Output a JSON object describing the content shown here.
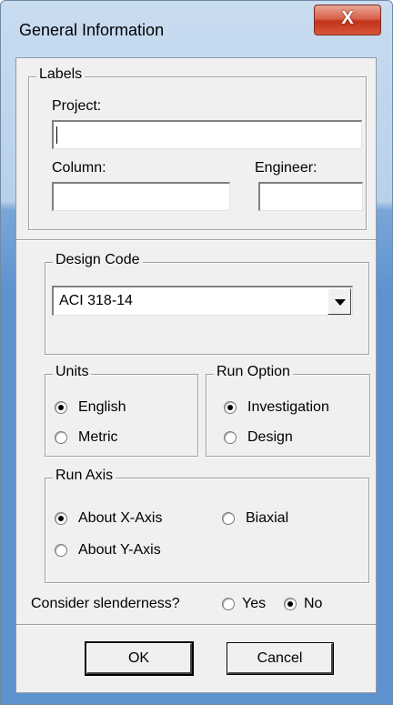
{
  "window": {
    "title": "General Information",
    "close_glyph": "X"
  },
  "labels_group": {
    "legend": "Labels",
    "project_label": "Project:",
    "project_value": "",
    "column_label": "Column:",
    "column_value": "",
    "engineer_label": "Engineer:",
    "engineer_value": ""
  },
  "design_code": {
    "legend": "Design Code",
    "selected": "ACI 318-14"
  },
  "units": {
    "legend": "Units",
    "options": [
      {
        "label": "English",
        "selected": true
      },
      {
        "label": "Metric",
        "selected": false
      }
    ]
  },
  "run_option": {
    "legend": "Run Option",
    "options": [
      {
        "label": "Investigation",
        "selected": true
      },
      {
        "label": "Design",
        "selected": false
      }
    ]
  },
  "run_axis": {
    "legend": "Run Axis",
    "options": [
      {
        "label": "About X-Axis",
        "selected": true
      },
      {
        "label": "Biaxial",
        "selected": false
      },
      {
        "label": "About Y-Axis",
        "selected": false
      }
    ]
  },
  "slenderness": {
    "label": "Consider slenderness?",
    "options": [
      {
        "label": "Yes",
        "selected": false
      },
      {
        "label": "No",
        "selected": true
      }
    ]
  },
  "buttons": {
    "ok": "OK",
    "cancel": "Cancel"
  }
}
